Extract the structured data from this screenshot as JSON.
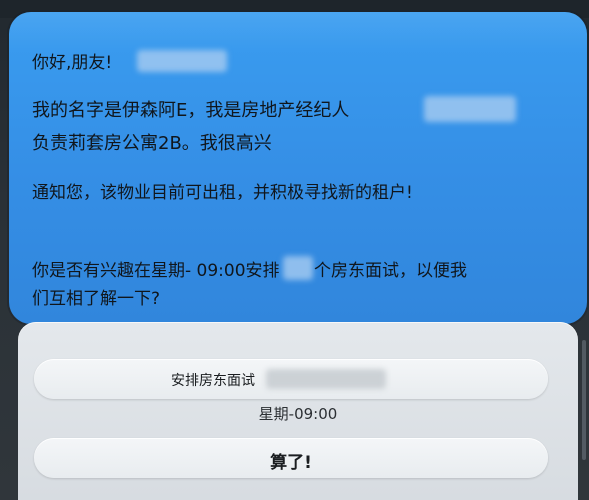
{
  "message": {
    "greeting": "你好,朋友!",
    "intro_line1": "我的名字是伊森阿E，我是房地产经纪人",
    "intro_line2": "负责莉套房公寓2B。我很高兴",
    "notice": "通知您，该物业目前可出租，并积极寻找新的租户!",
    "question_line1": "你是否有兴趣在星期- 09:00安排",
    "question_line1_tail": "个房东面试，以便我",
    "question_line2": "们互相了解一下?"
  },
  "actions": {
    "arrange_label": "安排房东面试",
    "time_label": "星期-09:00",
    "dismiss_label": "算了!"
  },
  "colors": {
    "bubble": "#3a9df0",
    "sheet": "#e4e8ec",
    "text": "#10161c"
  }
}
